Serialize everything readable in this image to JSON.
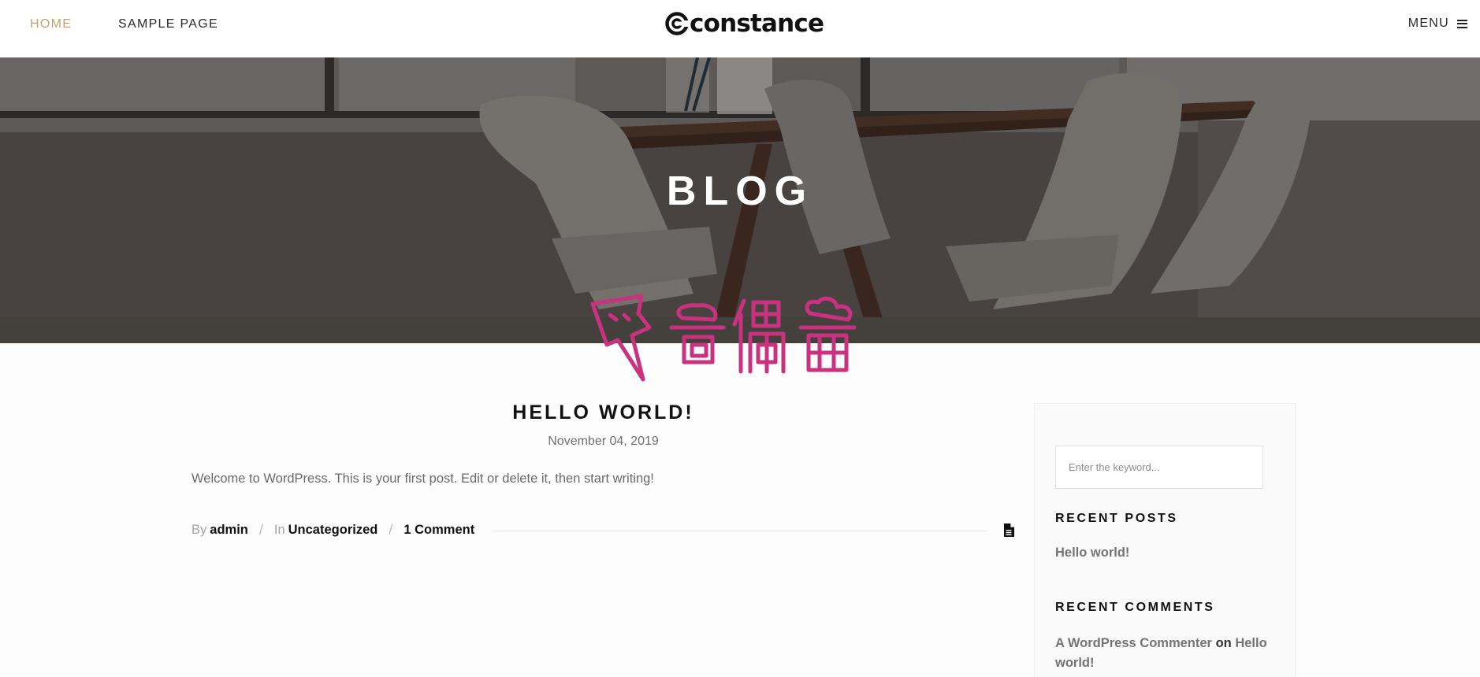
{
  "header": {
    "nav": [
      {
        "label": "HOME",
        "active": true
      },
      {
        "label": "SAMPLE PAGE",
        "active": false
      }
    ],
    "logo_text": "constance",
    "menu_label": "MENU",
    "accent_color": "#c3a36b"
  },
  "hero": {
    "title": "BLOG"
  },
  "watermark": {
    "text": "奇偶猫",
    "color": "#c8327f"
  },
  "post": {
    "title": "HELLO WORLD!",
    "date": "November 04, 2019",
    "excerpt": "Welcome to WordPress. This is your first post. Edit or delete it, then start writing!",
    "meta": {
      "by_label": "By",
      "author": "admin",
      "in_label": "In",
      "category": "Uncategorized",
      "comments": "1 Comment",
      "separator": "/"
    },
    "format_icon": "document-icon"
  },
  "sidebar": {
    "search_placeholder": "Enter the keyword...",
    "recent_posts_title": "RECENT POSTS",
    "recent_posts": [
      "Hello world!"
    ],
    "recent_comments_title": "RECENT COMMENTS",
    "recent_comment": {
      "author": "A WordPress Commenter",
      "on": "on",
      "post": "Hello world!"
    }
  }
}
